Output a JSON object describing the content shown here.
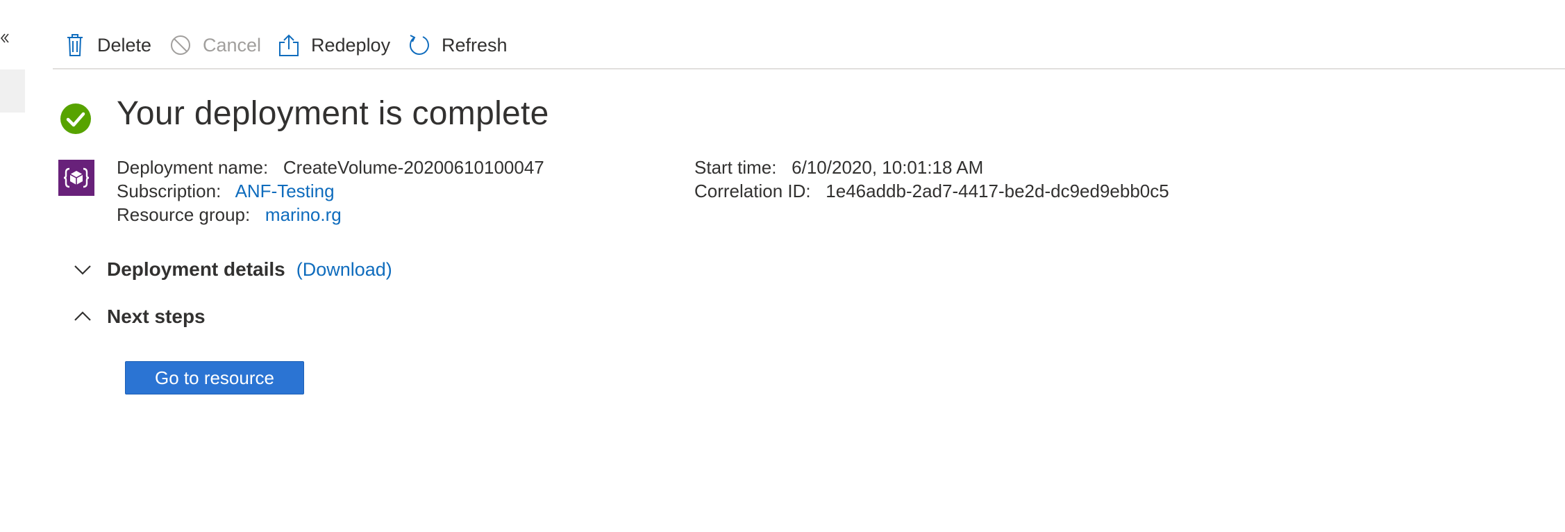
{
  "toolbar": {
    "delete_label": "Delete",
    "cancel_label": "Cancel",
    "redeploy_label": "Redeploy",
    "refresh_label": "Refresh"
  },
  "header": {
    "title": "Your deployment is complete"
  },
  "details": {
    "deployment_name_label": "Deployment name:",
    "deployment_name": "CreateVolume-20200610100047",
    "subscription_label": "Subscription:",
    "subscription": "ANF-Testing",
    "resource_group_label": "Resource group:",
    "resource_group": "marino.rg",
    "start_time_label": "Start time:",
    "start_time": "6/10/2020, 10:01:18 AM",
    "correlation_id_label": "Correlation ID:",
    "correlation_id": "1e46addb-2ad7-4417-be2d-dc9ed9ebb0c5"
  },
  "sections": {
    "deployment_details": "Deployment details",
    "download": "(Download)",
    "next_steps": "Next steps"
  },
  "actions": {
    "go_to_resource": "Go to resource"
  },
  "colors": {
    "accent": "#0f6cbd",
    "success": "#57a300",
    "deployment_icon_bg": "#68217a",
    "primary_button": "#2b74d3"
  },
  "icons": [
    "collapse-chevron-icon",
    "trash-icon",
    "cancel-icon",
    "redeploy-icon",
    "refresh-icon",
    "success-check-icon",
    "deployment-icon",
    "chevron-down-icon",
    "chevron-up-icon"
  ]
}
